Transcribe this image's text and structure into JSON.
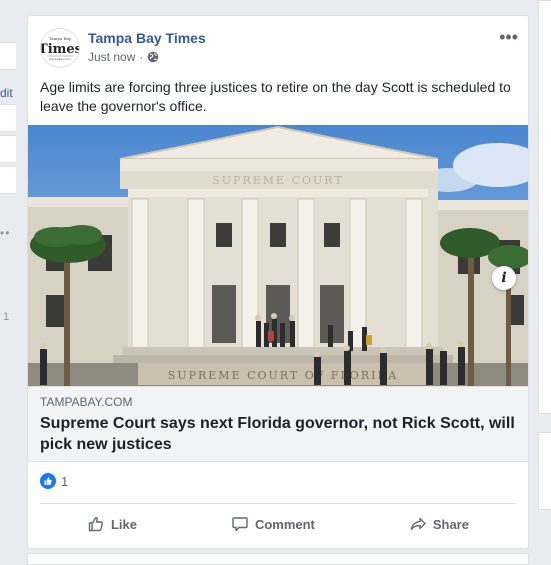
{
  "left_column": {
    "edit_label": "dit",
    "more_dots": "••",
    "count": "1"
  },
  "post": {
    "page_name": "Tampa Bay Times",
    "avatar_text": "Times",
    "timestamp": "Just now",
    "privacy_icon": "globe-icon",
    "more_icon": "more-options-icon",
    "more_symbol": "•••",
    "text": "Age limits are forcing three justices to retire on the day Scott is scheduled to leave the governor's office.",
    "photo_signage": "SUPREME COURT OF FLORIDA",
    "photo_pediment": "SUPREME COURT",
    "info_symbol": "i",
    "link": {
      "domain": "TAMPABAY.COM",
      "title": "Supreme Court says next Florida governor, not Rick Scott, will pick new justices"
    },
    "reactions": {
      "icon": "like-icon",
      "count": "1"
    },
    "actions": [
      {
        "label": "Like",
        "icon": "thumbs-up-icon"
      },
      {
        "label": "Comment",
        "icon": "comment-icon"
      },
      {
        "label": "Share",
        "icon": "share-icon"
      }
    ]
  },
  "colors": {
    "link_blue": "#385898",
    "like_blue": "#1877f2",
    "meta_gray": "#606770"
  }
}
